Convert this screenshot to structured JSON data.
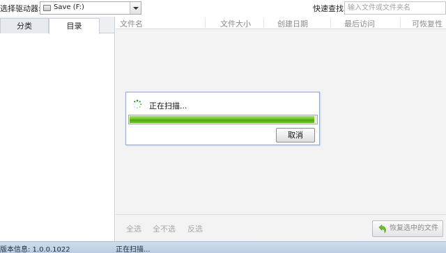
{
  "toolbar": {
    "drive_label": "选择驱动器:",
    "drive_value": "Save (F:)",
    "search_label": "快速查找:",
    "search_placeholder": "输入文件或文件夹名"
  },
  "left_panel": {
    "tabs": [
      {
        "label": "分类",
        "active": false
      },
      {
        "label": "目录",
        "active": true
      }
    ]
  },
  "file_list": {
    "columns": [
      "文件名",
      "文件大小",
      "创建日期",
      "最后访问",
      "可恢复性"
    ]
  },
  "scan_dialog": {
    "message": "正在扫描...",
    "progress": 0.99,
    "cancel_label": "取消"
  },
  "bottom": {
    "select_all": "全选",
    "select_none": "全不选",
    "invert": "反选",
    "restore_label": "恢复选中的文件"
  },
  "status": {
    "version": "版本信息: 1.0.0.1022",
    "text": "正在扫描..."
  },
  "colors": {
    "progress_green": "#6cc21f",
    "status_bar": "#c6d6ea",
    "dialog_border": "#8da8c8"
  }
}
